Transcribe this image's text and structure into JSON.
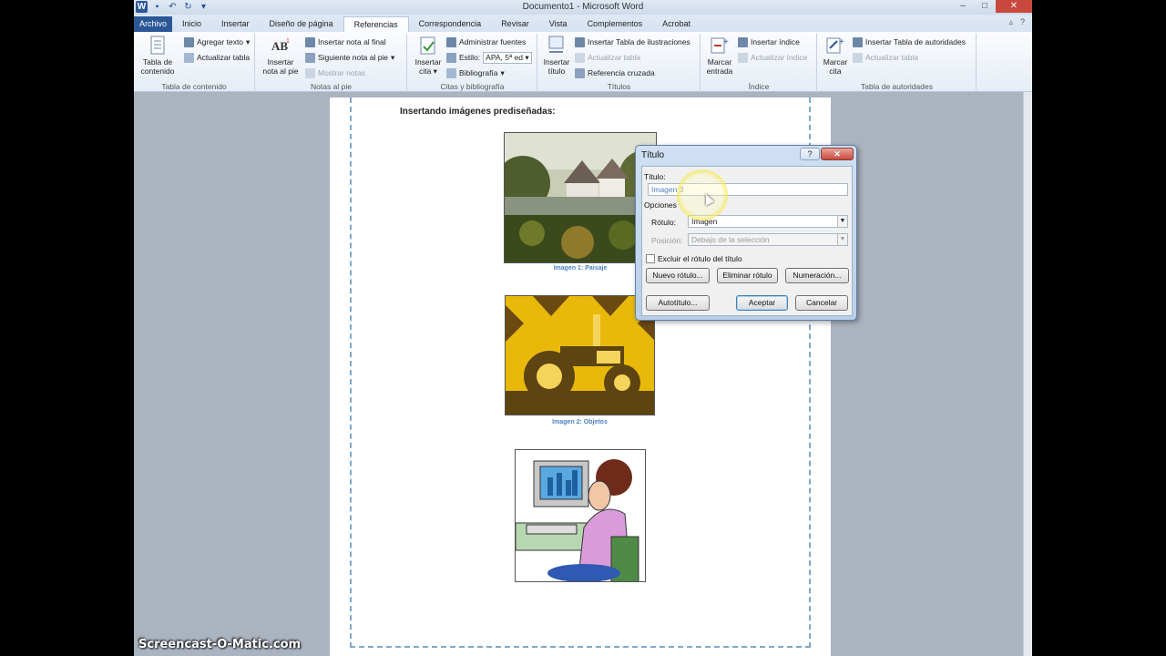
{
  "window": {
    "title": "Documento1 - Microsoft Word"
  },
  "qat": {
    "icons": [
      "word-icon",
      "save-icon",
      "undo-icon",
      "redo-icon",
      "customize-icon"
    ]
  },
  "tabs": [
    {
      "label": "Archivo"
    },
    {
      "label": "Inicio"
    },
    {
      "label": "Insertar"
    },
    {
      "label": "Diseño de página"
    },
    {
      "label": "Referencias"
    },
    {
      "label": "Correspondencia"
    },
    {
      "label": "Revisar"
    },
    {
      "label": "Vista"
    },
    {
      "label": "Complementos"
    },
    {
      "label": "Acrobat"
    }
  ],
  "ribbon": {
    "tabla_contenido": {
      "big_label": "Tabla de contenido",
      "agregar_texto": "Agregar texto",
      "actualizar_tabla": "Actualizar tabla",
      "group": "Tabla de contenido"
    },
    "notas_pie": {
      "big_label": "Insertar nota al pie",
      "insertar_nota_final": "Insertar nota al final",
      "siguiente_nota": "Siguiente nota al pie",
      "mostrar_notas": "Mostrar notas",
      "group": "Notas al pie"
    },
    "citas": {
      "big_label": "Insertar cita",
      "administrar": "Administrar fuentes",
      "estilo_label": "Estilo:",
      "estilo_value": "APA, 5ª ed",
      "bibliografia": "Bibliografía",
      "group": "Citas y bibliografía"
    },
    "titulos": {
      "big_label": "Insertar título",
      "insertar_tabla_ilustraciones": "Insertar Tabla de ilustraciones",
      "actualizar_tabla": "Actualizar tabla",
      "referencia_cruzada": "Referencia cruzada",
      "group": "Títulos"
    },
    "indice": {
      "big_label": "Marcar entrada",
      "insertar_indice": "Insertar índice",
      "actualizar_indice": "Actualizar índice",
      "group": "Índice"
    },
    "autoridades": {
      "big_label": "Marcar cita",
      "insertar_tabla_autoridades": "Insertar Tabla de autoridades",
      "actualizar_tabla": "Actualizar tabla",
      "group": "Tabla de autoridades"
    }
  },
  "document": {
    "heading": "Insertando imágenes prediseñadas:",
    "captions": [
      "Imagen 1: Paisaje",
      "Imagen 2: Objetos"
    ]
  },
  "dialog": {
    "title": "Título",
    "help": "?",
    "close": "✕",
    "titulo_label": "Título:",
    "titulo_value": "Imagen 3",
    "opciones_label": "Opciones",
    "rotulo_label": "Rótulo:",
    "rotulo_value": "Imagen",
    "posicion_label": "Posición:",
    "posicion_value": "Debajo de la selección",
    "excluir_label": "Excluir el rótulo del título",
    "nuevo_rotulo": "Nuevo rótulo...",
    "eliminar_rotulo": "Eliminar rótulo",
    "numeracion": "Numeración...",
    "autotitulo": "Autotítulo...",
    "aceptar": "Aceptar",
    "cancelar": "Cancelar"
  },
  "watermark": "Screencast-O-Matic.com",
  "colors": {
    "file_tab": "#2b5797",
    "caption": "#4f81bd",
    "close_button": "#c9483d",
    "tractor_yellow": "#e8b90a"
  }
}
